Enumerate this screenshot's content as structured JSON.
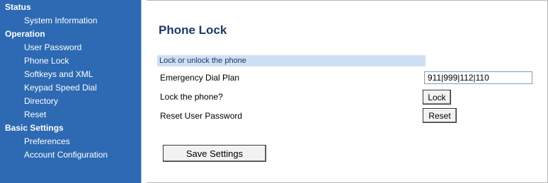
{
  "sidebar": {
    "sections": [
      {
        "label": "Status",
        "items": [
          "System Information"
        ]
      },
      {
        "label": "Operation",
        "items": [
          "User Password",
          "Phone Lock",
          "Softkeys and XML",
          "Keypad Speed Dial",
          "Directory",
          "Reset"
        ]
      },
      {
        "label": "Basic Settings",
        "items": [
          "Preferences",
          "Account Configuration"
        ]
      }
    ]
  },
  "main": {
    "title": "Phone Lock",
    "banner": "Lock or unlock the phone",
    "rows": {
      "emergency_label": "Emergency Dial Plan",
      "emergency_value": "911|999|112|110",
      "lock_label": "Lock the phone?",
      "lock_button": "Lock",
      "reset_label": "Reset User Password",
      "reset_button": "Reset"
    },
    "save_button": "Save Settings"
  },
  "colors": {
    "sidebar_bg": "#2d6ab3",
    "banner_bg": "#cfe0f5",
    "title": "#1b3a66"
  }
}
